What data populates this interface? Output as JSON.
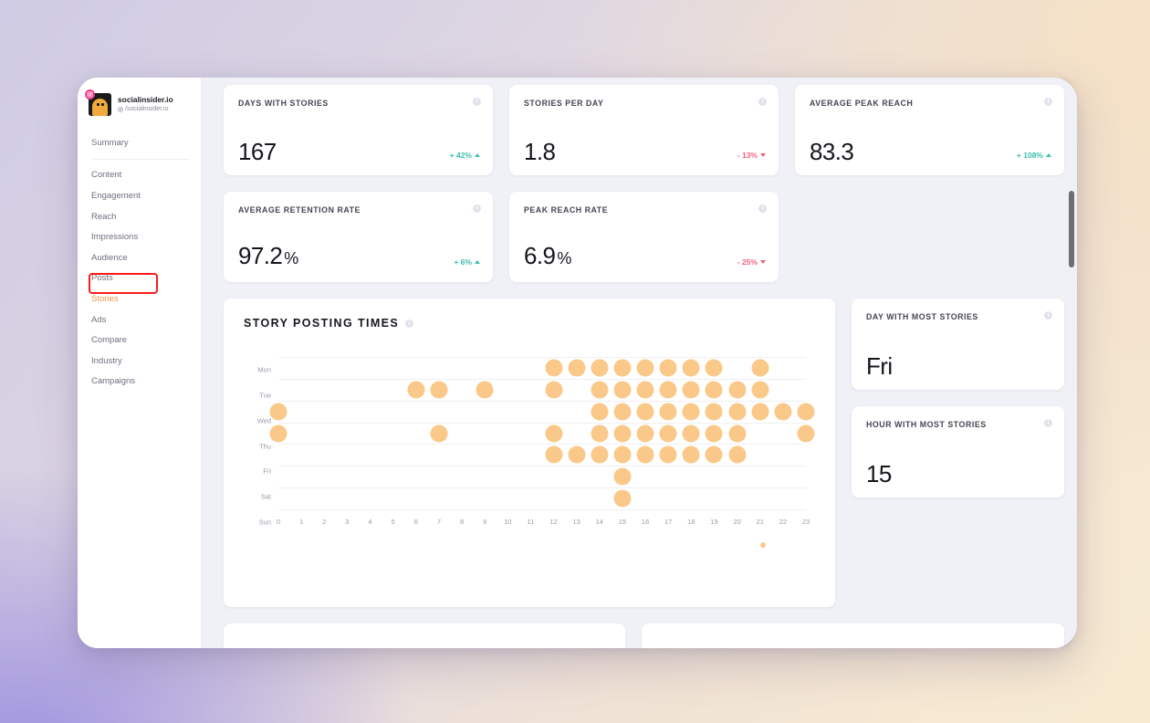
{
  "profile": {
    "name": "socialinsider.io",
    "handle": "/socialinsider.io",
    "platform_icon": "instagram-icon",
    "badge_icon": "instagram-badge-icon"
  },
  "sidebar": {
    "items": [
      {
        "label": "Summary",
        "active": false
      },
      {
        "label": "Content",
        "active": false
      },
      {
        "label": "Engagement",
        "active": false
      },
      {
        "label": "Reach",
        "active": false
      },
      {
        "label": "Impressions",
        "active": false
      },
      {
        "label": "Audience",
        "active": false
      },
      {
        "label": "Posts",
        "active": false
      },
      {
        "label": "Stories",
        "active": true
      },
      {
        "label": "Ads",
        "active": false
      },
      {
        "label": "Compare",
        "active": false
      },
      {
        "label": "Industry",
        "active": false
      },
      {
        "label": "Campaigns",
        "active": false
      }
    ],
    "highlight_color": "#fa1b1b",
    "active_color": "#f0954a"
  },
  "kpis": [
    {
      "title": "DAYS WITH STORIES",
      "value": "167",
      "unit": "",
      "delta": "+ 42%",
      "direction": "up"
    },
    {
      "title": "STORIES PER DAY",
      "value": "1.8",
      "unit": "",
      "delta": "- 13%",
      "direction": "down"
    },
    {
      "title": "AVERAGE PEAK REACH",
      "value": "83.3",
      "unit": "",
      "delta": "+ 108%",
      "direction": "up"
    },
    {
      "title": "AVERAGE RETENTION RATE",
      "value": "97.2",
      "unit": "%",
      "delta": "+ 6%",
      "direction": "up"
    },
    {
      "title": "PEAK REACH RATE",
      "value": "6.9",
      "unit": "%",
      "delta": "- 25%",
      "direction": "down"
    }
  ],
  "info_icon_glyph": "i",
  "side_cards": [
    {
      "title": "DAY WITH MOST STORIES",
      "value": "Fri"
    },
    {
      "title": "HOUR WITH MOST STORIES",
      "value": "15"
    }
  ],
  "colors": {
    "positive": "#38bfae",
    "negative": "#f2607a",
    "bubble": "#fac989",
    "card_bg": "#ffffff",
    "canvas_bg": "#f0f1f6"
  },
  "chart_data": {
    "type": "scatter",
    "title": "STORY POSTING TIMES",
    "xlabel": "",
    "ylabel": "",
    "grid": true,
    "legend_position": "bottom-right",
    "legend_marker_color": "#fac989",
    "xlim": [
      0,
      23
    ],
    "x_ticks": [
      "0",
      "1",
      "2",
      "3",
      "4",
      "5",
      "6",
      "7",
      "8",
      "9",
      "10",
      "11",
      "12",
      "13",
      "14",
      "15",
      "16",
      "17",
      "18",
      "19",
      "20",
      "21",
      "22",
      "23"
    ],
    "y_categories": [
      "Mon",
      "Tue",
      "Wed",
      "Thu",
      "Fri",
      "Sat",
      "Sun"
    ],
    "points": [
      {
        "day": "Mon",
        "hours": [
          12,
          13,
          14,
          15,
          16,
          17,
          18,
          19,
          21
        ]
      },
      {
        "day": "Tue",
        "hours": [
          6,
          7,
          9,
          12,
          14,
          15,
          16,
          17,
          18,
          19,
          20,
          21
        ]
      },
      {
        "day": "Wed",
        "hours": [
          0,
          14,
          15,
          16,
          17,
          18,
          19,
          20,
          21,
          22,
          23
        ]
      },
      {
        "day": "Thu",
        "hours": [
          0,
          7,
          12,
          14,
          15,
          16,
          17,
          18,
          19,
          20,
          23
        ]
      },
      {
        "day": "Fri",
        "hours": [
          12,
          13,
          14,
          15,
          16,
          17,
          18,
          19,
          20
        ]
      },
      {
        "day": "Sat",
        "hours": [
          15
        ]
      },
      {
        "day": "Sun",
        "hours": [
          15
        ]
      }
    ]
  }
}
